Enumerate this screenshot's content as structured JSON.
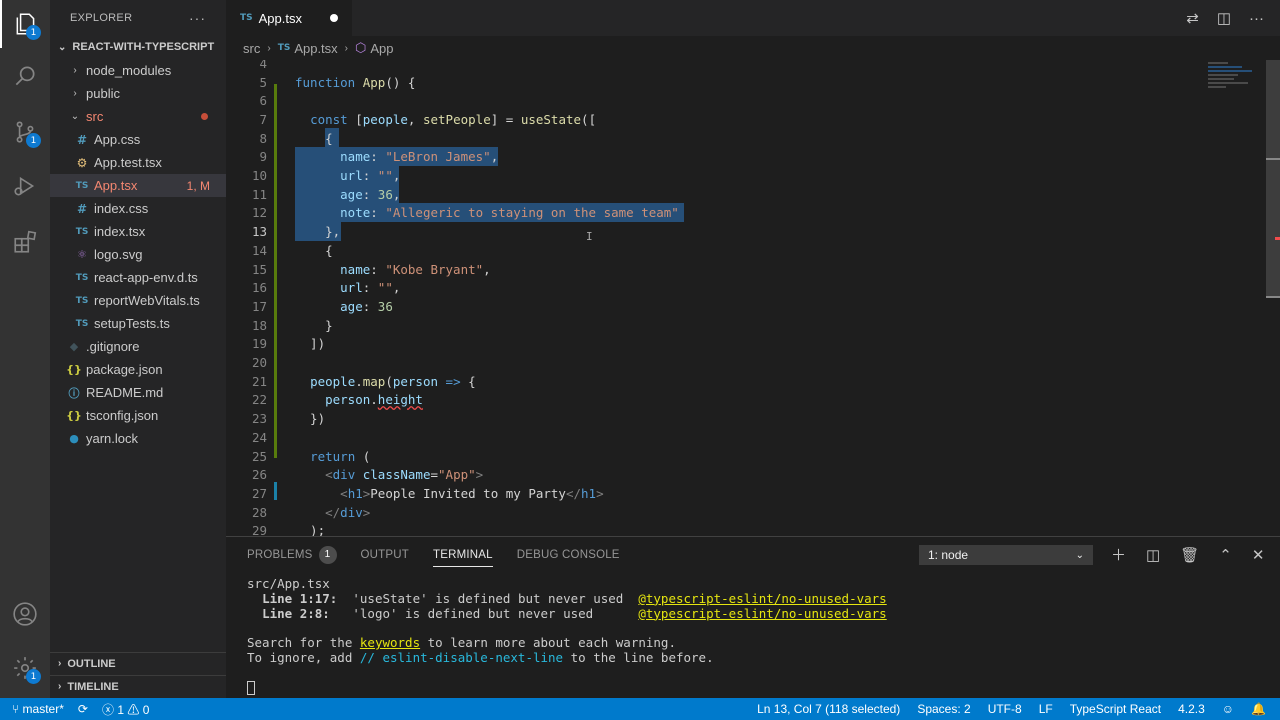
{
  "sidebar": {
    "title": "EXPLORER",
    "more": "···",
    "project": "REACT-WITH-TYPESCRIPT",
    "items": [
      {
        "label": "node_modules",
        "type": "folder",
        "expanded": false,
        "indent": 1
      },
      {
        "label": "public",
        "type": "folder",
        "expanded": false,
        "indent": 1
      },
      {
        "label": "src",
        "type": "folder",
        "expanded": true,
        "indent": 1
      },
      {
        "label": "App.css",
        "type": "css",
        "indent": 2
      },
      {
        "label": "App.test.tsx",
        "type": "gear",
        "indent": 2
      },
      {
        "label": "App.tsx",
        "type": "ts",
        "indent": 2,
        "badge": "1, M"
      },
      {
        "label": "index.css",
        "type": "css",
        "indent": 2
      },
      {
        "label": "index.tsx",
        "type": "ts",
        "indent": 2
      },
      {
        "label": "logo.svg",
        "type": "logo",
        "indent": 2
      },
      {
        "label": "react-app-env.d.ts",
        "type": "ts",
        "indent": 2
      },
      {
        "label": "reportWebVitals.ts",
        "type": "ts",
        "indent": 2
      },
      {
        "label": "setupTests.ts",
        "type": "ts",
        "indent": 2
      },
      {
        "label": ".gitignore",
        "type": "git",
        "indent": 1
      },
      {
        "label": "package.json",
        "type": "json",
        "indent": 1
      },
      {
        "label": "README.md",
        "type": "info",
        "indent": 1
      },
      {
        "label": "tsconfig.json",
        "type": "json",
        "indent": 1
      },
      {
        "label": "yarn.lock",
        "type": "yarn",
        "indent": 1
      }
    ],
    "outline": "OUTLINE",
    "timeline": "TIMELINE"
  },
  "activity": {
    "explorer_badge": "1",
    "scm_badge": "1",
    "settings_badge": "1"
  },
  "tab": {
    "ts_label": "TS",
    "name": "App.tsx"
  },
  "breadcrumb": {
    "folder": "src",
    "ts_label": "TS",
    "file": "App.tsx",
    "symbol": "App"
  },
  "code_lines": [
    {
      "n": "4",
      "html": ""
    },
    {
      "n": "5",
      "html": "<span class='kw'>function</span> <span class='fn'>App</span>() {"
    },
    {
      "n": "6",
      "html": ""
    },
    {
      "n": "7",
      "html": "  <span class='kw'>const</span> [<span class='var'>people</span>, <span class='fn'>setPeople</span>] = <span class='fn'>useState</span>(["
    },
    {
      "n": "8",
      "html": "    {"
    },
    {
      "n": "9",
      "html": "      <span class='var'>name</span>: <span class='str'>\"LeBron James\"</span>,"
    },
    {
      "n": "10",
      "html": "      <span class='var'>url</span>: <span class='str'>\"\"</span>,"
    },
    {
      "n": "11",
      "html": "      <span class='var'>age</span>: <span class='num'>36</span>,"
    },
    {
      "n": "12",
      "html": "      <span class='var'>note</span>: <span class='str'>\"Allegeric to staying on the same team\"</span>"
    },
    {
      "n": "13",
      "html": "    },"
    },
    {
      "n": "14",
      "html": "    {"
    },
    {
      "n": "15",
      "html": "      <span class='var'>name</span>: <span class='str'>\"Kobe Bryant\"</span>,"
    },
    {
      "n": "16",
      "html": "      <span class='var'>url</span>: <span class='str'>\"\"</span>,"
    },
    {
      "n": "17",
      "html": "      <span class='var'>age</span>: <span class='num'>36</span>"
    },
    {
      "n": "18",
      "html": "    }"
    },
    {
      "n": "19",
      "html": "  ])"
    },
    {
      "n": "20",
      "html": ""
    },
    {
      "n": "21",
      "html": "  <span class='var'>people</span>.<span class='fn'>map</span>(<span class='var'>person</span> <span class='kw'>=&gt;</span> {"
    },
    {
      "n": "22",
      "html": "    <span class='var'>person</span>.<span class='var squig'>height</span>"
    },
    {
      "n": "23",
      "html": "  })"
    },
    {
      "n": "24",
      "html": ""
    },
    {
      "n": "25",
      "html": "  <span class='kw'>return</span> ("
    },
    {
      "n": "26",
      "html": "    <span class='tagp'>&lt;</span><span class='tag'>div</span> <span class='attr'>className</span>=<span class='str'>\"App\"</span><span class='tagp'>&gt;</span>"
    },
    {
      "n": "27",
      "html": "      <span class='tagp'>&lt;</span><span class='tag'>h1</span><span class='tagp'>&gt;</span>People Invited to my Party<span class='tagp'>&lt;/</span><span class='tag'>h1</span><span class='tagp'>&gt;</span>"
    },
    {
      "n": "28",
      "html": "    <span class='tagp'>&lt;/</span><span class='tag'>div</span><span class='tagp'>&gt;</span>"
    },
    {
      "n": "29",
      "html": "  );"
    }
  ],
  "panel": {
    "tabs": [
      {
        "label": "PROBLEMS",
        "badge": "1"
      },
      {
        "label": "OUTPUT"
      },
      {
        "label": "TERMINAL",
        "active": true
      },
      {
        "label": "DEBUG CONSOLE"
      }
    ],
    "terminal_select": "1: node",
    "terminal_lines": [
      "src/App.tsx",
      "  <span class='t-bold'>Line 1:17:</span>  'useState' is defined but never used  <span class='t-yellow'>@typescript-eslint/no-unused-vars</span>",
      "  <span class='t-bold'>Line 2:8:</span>   'logo' is defined but never used      <span class='t-yellow'>@typescript-eslint/no-unused-vars</span>",
      "",
      "Search for the <span class='t-yellow'>keywords</span> to learn more about each warning.",
      "To ignore, add <span class='t-cyan'>// eslint-disable-next-line</span> to the line before.",
      "",
      "<span class='t-cursor'></span>"
    ]
  },
  "status": {
    "branch": "master*",
    "errors": "1",
    "warnings": "0",
    "position": "Ln 13, Col 7 (118 selected)",
    "spaces": "Spaces: 2",
    "encoding": "UTF-8",
    "eol": "LF",
    "language": "TypeScript React",
    "version": "4.2.3"
  }
}
